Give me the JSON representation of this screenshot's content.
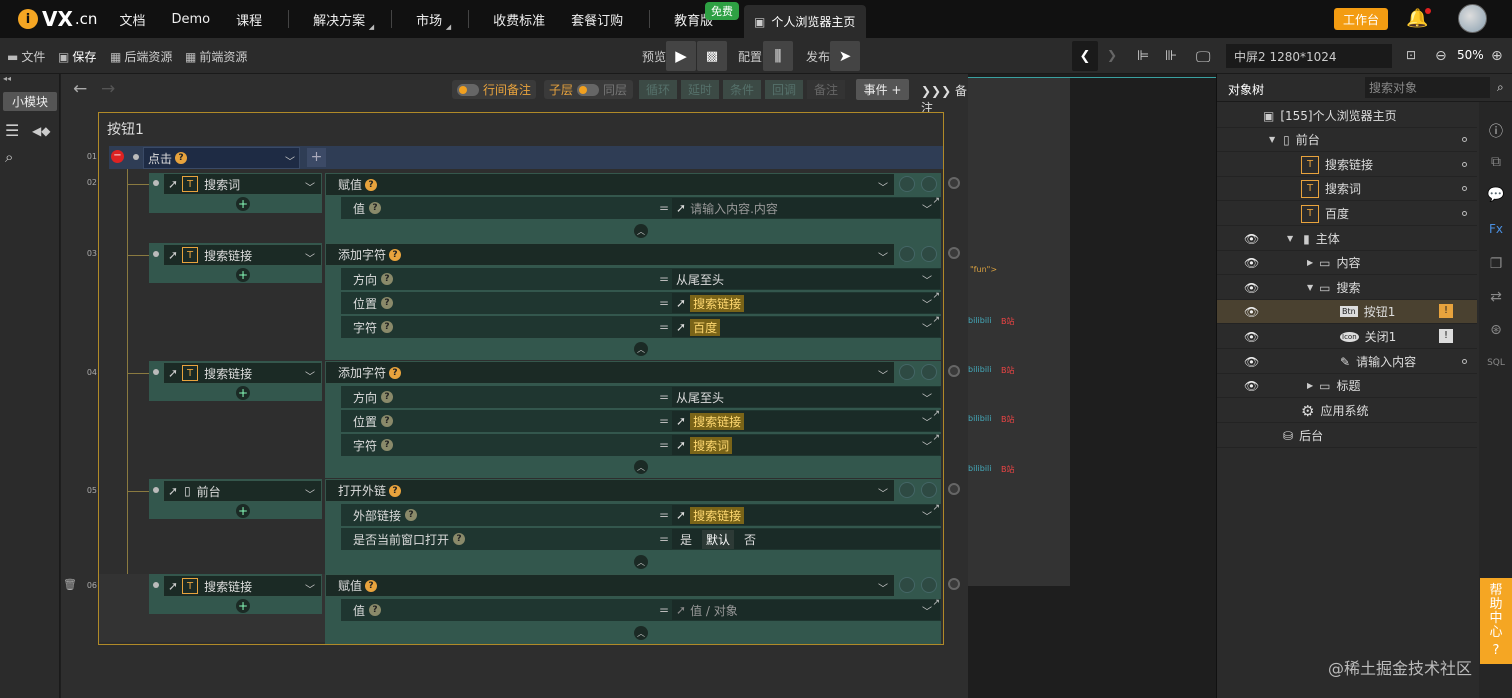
{
  "brand": {
    "logo_i": "i",
    "logo_vx": "VX",
    "logo_cn": ".cn"
  },
  "nav": {
    "items": [
      "文档",
      "Demo",
      "课程",
      "解决方案",
      "市场",
      "收费标准",
      "套餐订购",
      "教育版"
    ],
    "free_badge": "免费",
    "active_tab": "个人浏览器主页",
    "work_button": "工作台"
  },
  "toolbar": {
    "file": "文件",
    "save": "保存",
    "backend": "后端资源",
    "frontend": "前端资源",
    "preview": "预览",
    "config": "配置",
    "publish": "发布",
    "screen": "中屏2 1280*1024",
    "zoom": "50%"
  },
  "left": {
    "small_module": "小模块"
  },
  "editor": {
    "row_note": "行间备注",
    "sublayer": "子层",
    "same_layer": "同层",
    "dim_buttons": [
      "循环",
      "延时",
      "条件",
      "回调",
      "备注"
    ],
    "event_button": "事件 +",
    "note_button": "备注",
    "frame_title": "按钮1",
    "trigger": "点击",
    "line_numbers": [
      "01",
      "02",
      "03",
      "04",
      "05",
      "06"
    ],
    "blocks": [
      {
        "target": "搜索词",
        "action": "赋值",
        "params": [
          {
            "label": "值",
            "value": "请输入内容.内容",
            "kind": "ph"
          }
        ]
      },
      {
        "target": "搜索链接",
        "action": "添加字符",
        "params": [
          {
            "label": "方向",
            "value": "从尾至头",
            "kind": "plain"
          },
          {
            "label": "位置",
            "value": "搜索链接",
            "kind": "hl"
          },
          {
            "label": "字符",
            "value": "百度",
            "kind": "hl"
          }
        ]
      },
      {
        "target": "搜索链接",
        "action": "添加字符",
        "params": [
          {
            "label": "方向",
            "value": "从尾至头",
            "kind": "plain"
          },
          {
            "label": "位置",
            "value": "搜索链接",
            "kind": "hl"
          },
          {
            "label": "字符",
            "value": "搜索词",
            "kind": "hl"
          }
        ]
      },
      {
        "target": "前台",
        "action": "打开外链",
        "params": [
          {
            "label": "外部链接",
            "value": "搜索链接",
            "kind": "hl"
          },
          {
            "label": "是否当前窗口打开",
            "value": "",
            "kind": "radio"
          }
        ]
      },
      {
        "target": "搜索链接",
        "action": "赋值",
        "params": [
          {
            "label": "值",
            "value": "值 / 对象",
            "kind": "ph"
          }
        ]
      }
    ],
    "radio_options": [
      "是",
      "默认",
      "否"
    ]
  },
  "preview": {
    "fun": "\"fun\">",
    "bili": "bilibili",
    "bi": "B站"
  },
  "tree": {
    "tab": "对象树",
    "search_placeholder": "搜索对象",
    "rows": [
      {
        "label": "[155]个人浏览器主页"
      },
      {
        "label": "前台"
      },
      {
        "label": "搜索链接"
      },
      {
        "label": "搜索词"
      },
      {
        "label": "百度"
      },
      {
        "label": "主体"
      },
      {
        "label": "内容"
      },
      {
        "label": "搜索"
      },
      {
        "label": "按钮1"
      },
      {
        "label": "关闭1"
      },
      {
        "label": "请输入内容"
      },
      {
        "label": "标题"
      },
      {
        "label": "应用系统"
      },
      {
        "label": "后台"
      }
    ],
    "icon_btn": "Btn",
    "icon_icon": "Icon"
  },
  "help": "帮助中心",
  "watermark": "@稀土掘金技术社区"
}
